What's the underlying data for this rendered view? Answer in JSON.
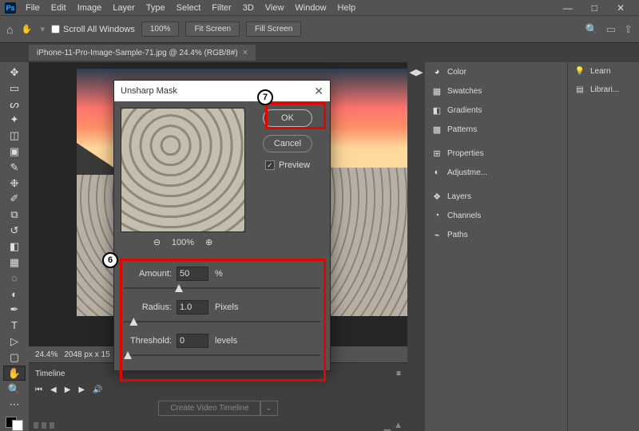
{
  "menu": {
    "items": [
      "File",
      "Edit",
      "Image",
      "Layer",
      "Type",
      "Select",
      "Filter",
      "3D",
      "View",
      "Window",
      "Help"
    ]
  },
  "win": {
    "min": "—",
    "max": "□",
    "close": "✕"
  },
  "optbar": {
    "scroll_all": "Scroll All Windows",
    "zoom_pct": "100%",
    "fit": "Fit Screen",
    "fill": "Fill Screen"
  },
  "doc_tab": {
    "title": "iPhone-11-Pro-Image-Sample-71.jpg @ 24.4% (RGB/8#)",
    "close": "×"
  },
  "status": {
    "zoom": "24.4%",
    "dims": "2048 px x 15"
  },
  "timeline": {
    "title": "Timeline",
    "create": "Create Video Timeline"
  },
  "right": {
    "color": "Color",
    "swatches": "Swatches",
    "gradients": "Gradients",
    "patterns": "Patterns",
    "properties": "Properties",
    "adjustments": "Adjustme...",
    "layers": "Layers",
    "channels": "Channels",
    "paths": "Paths"
  },
  "rcol2": {
    "learn": "Learn",
    "libraries": "Librari..."
  },
  "dialog": {
    "title": "Unsharp Mask",
    "ok": "OK",
    "cancel": "Cancel",
    "preview": "Preview",
    "zoom": "100%",
    "amount_label": "Amount:",
    "amount": "50",
    "amount_unit": "%",
    "radius_label": "Radius:",
    "radius": "1.0",
    "radius_unit": "Pixels",
    "threshold_label": "Threshold:",
    "threshold": "0",
    "threshold_unit": "levels"
  },
  "annot": {
    "n6": "6",
    "n7": "7"
  }
}
